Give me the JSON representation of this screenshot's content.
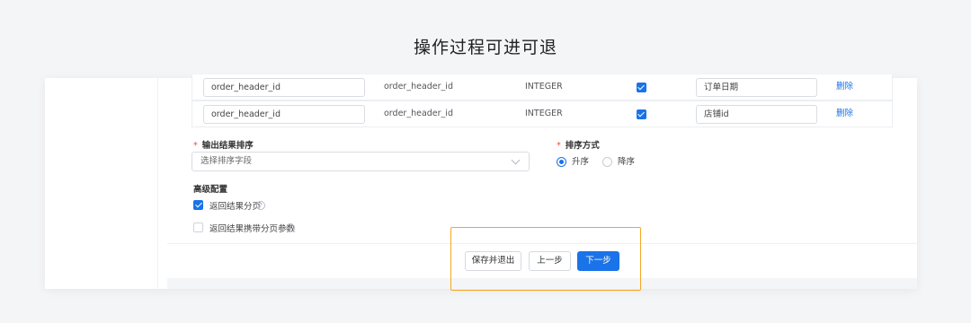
{
  "page_title": "操作过程可进可退",
  "field_table": {
    "rows": [
      {
        "field_input": "order_header_id",
        "field_name": "order_header_id",
        "type": "INTEGER",
        "checked": true,
        "comment": "订单日期",
        "delete_label": "删除"
      },
      {
        "field_input": "order_header_id",
        "field_name": "order_header_id",
        "type": "INTEGER",
        "checked": true,
        "comment": "店铺id",
        "delete_label": "删除"
      }
    ]
  },
  "sort": {
    "field_label": "输出结果排序",
    "field_placeholder": "选择排序字段",
    "method_label": "排序方式",
    "options": [
      "升序",
      "降序"
    ],
    "selected": "升序"
  },
  "advanced": {
    "title": "高级配置",
    "paginate_label": "返回结果分页",
    "paginate_checked": true,
    "carry_params_label": "返回结果携带分页参数",
    "carry_params_checked": false,
    "help_glyph": "?"
  },
  "footer": {
    "save_exit_label": "保存并退出",
    "prev_label": "上一步",
    "next_label": "下一步"
  },
  "colors": {
    "primary": "#1a73e8",
    "required": "#f5483b",
    "highlight": "#f5a623"
  }
}
